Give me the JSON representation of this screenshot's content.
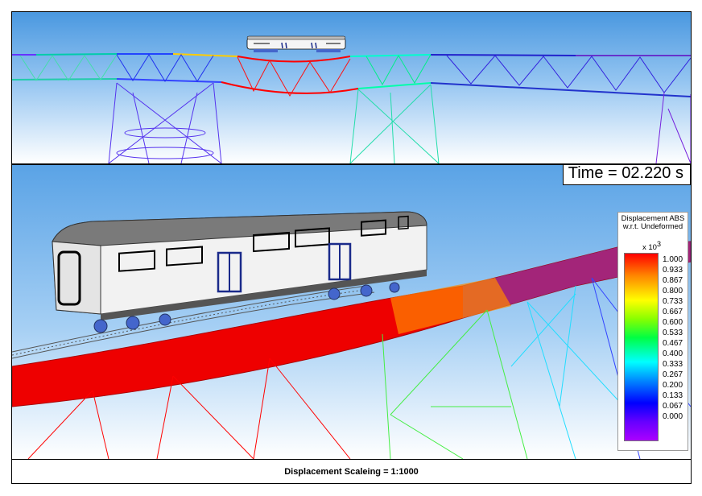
{
  "time_label": "Time = 02.220 s",
  "legend": {
    "title_line1": "Displacement ABS",
    "title_line2": "w.r.t. Undeformed",
    "multiplier": "x 10",
    "exponent": "3",
    "ticks": [
      "1.000",
      "0.933",
      "0.867",
      "0.800",
      "0.733",
      "0.667",
      "0.600",
      "0.533",
      "0.467",
      "0.400",
      "0.333",
      "0.267",
      "0.200",
      "0.133",
      "0.067",
      "0.000"
    ],
    "colors": [
      "#ff0000",
      "#ff8800",
      "#ffff00",
      "#00ff44",
      "#00ffff",
      "#0000ff",
      "#aa00ff"
    ]
  },
  "caption": "Displacement Scaleing = 1:1000",
  "colors": {
    "sky_top": "#4a98e0",
    "sky_bottom": "#ffffff",
    "train_body": "#f2f2f2",
    "train_roof": "#7a7a7a",
    "door_blue": "#1a2a8a",
    "bogie_blue": "#4466cc"
  }
}
